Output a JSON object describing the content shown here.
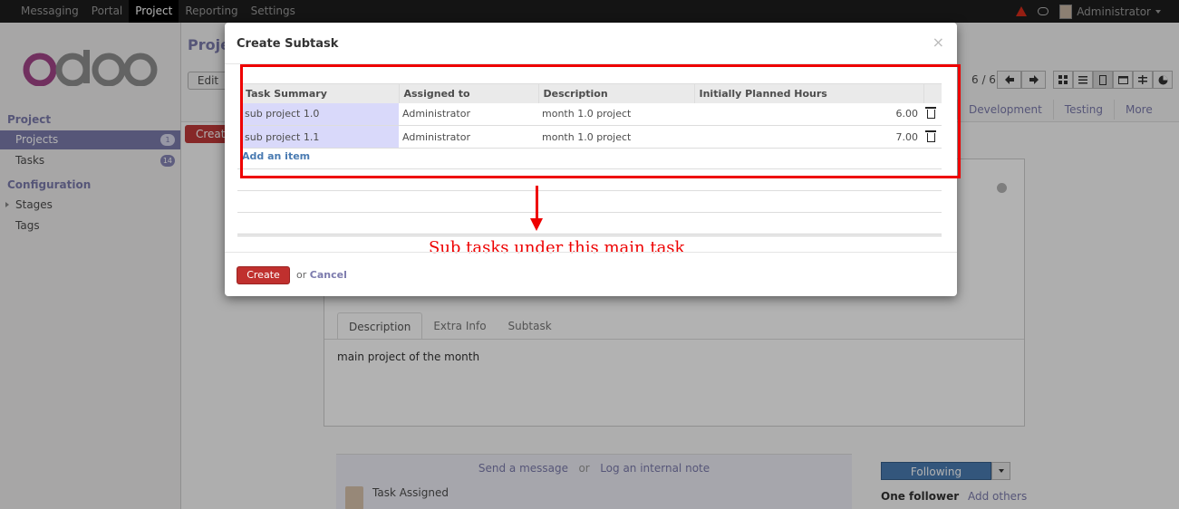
{
  "topbar": {
    "menu": [
      "Messaging",
      "Portal",
      "Project",
      "Reporting",
      "Settings"
    ],
    "active_index": 2,
    "user": "Administrator"
  },
  "sidebar": {
    "section1": "Project",
    "items1": [
      {
        "label": "Projects",
        "badge": "1"
      },
      {
        "label": "Tasks",
        "badge": "14"
      }
    ],
    "section2": "Configuration",
    "items2": [
      {
        "label": "Stages"
      },
      {
        "label": "Tags"
      }
    ]
  },
  "background": {
    "title": "Proje",
    "edit_label": "Edit",
    "create_label": "Create",
    "pager": "6 / 6",
    "stages": [
      "Development",
      "Testing",
      "More"
    ],
    "tabs": [
      "Description",
      "Extra Info",
      "Subtask"
    ],
    "description": "main project of the month",
    "chatter_send": "Send a message",
    "chatter_or": "or",
    "chatter_log": "Log an internal note",
    "chatter_item": "Task Assigned",
    "following_label": "Following",
    "followers_count": "One follower",
    "add_others": "Add others"
  },
  "modal": {
    "title": "Create Subtask",
    "close": "×",
    "columns": [
      "Task Summary",
      "Assigned to",
      "Description",
      "Initially Planned Hours"
    ],
    "rows": [
      {
        "summary": "sub project 1.0",
        "assigned": "Administrator",
        "description": "month 1.0 project",
        "hours": "6.00"
      },
      {
        "summary": "sub project 1.1",
        "assigned": "Administrator",
        "description": "month 1.0 project",
        "hours": "7.00"
      }
    ],
    "add_item": "Add an item",
    "annotation": "Sub tasks under this main task",
    "create_label": "Create",
    "or_text": "or",
    "cancel_label": "Cancel"
  },
  "colors": {
    "accent": "#7c7bad",
    "danger": "#c0302e",
    "annotation": "#ee0000"
  }
}
